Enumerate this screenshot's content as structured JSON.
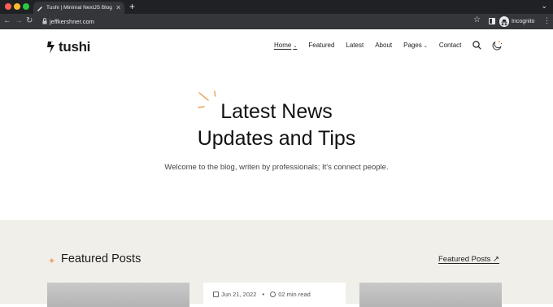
{
  "browser": {
    "tab_title": "Tushi | Minimal NextJS Blog Te",
    "tab_close": "✕",
    "new_tab": "+",
    "url": "jeffkershner.com",
    "profile_label": "Incognito",
    "icons": {
      "back": "back-arrow-icon",
      "forward": "forward-arrow-icon",
      "reload": "reload-icon",
      "star": "star-icon",
      "kebab": "kebab-menu-icon"
    }
  },
  "site": {
    "logo_text": "tushi",
    "nav": [
      {
        "label": "Home",
        "has_caret": true,
        "active": true
      },
      {
        "label": "Featured",
        "has_caret": false,
        "active": false
      },
      {
        "label": "Latest",
        "has_caret": false,
        "active": false
      },
      {
        "label": "About",
        "has_caret": false,
        "active": false
      },
      {
        "label": "Pages",
        "has_caret": true,
        "active": false
      },
      {
        "label": "Contact",
        "has_caret": false,
        "active": false
      }
    ],
    "caret_glyph": "⌄"
  },
  "hero": {
    "title_line1": "Latest News",
    "title_line2": "Updates and Tips",
    "subtitle": "Welcome to the blog, writen by professionals; It's connect people."
  },
  "featured": {
    "title": "Featured Posts",
    "link_label": "Featured Posts ↗",
    "card_date": "Jun 21, 2022",
    "card_separator": "•",
    "card_read_time": "02 min read"
  },
  "colors": {
    "accent_orange": "#e8a04a",
    "featured_bg": "#f0efe9",
    "browser_dark": "#202124",
    "browser_toolbar": "#35363a"
  }
}
